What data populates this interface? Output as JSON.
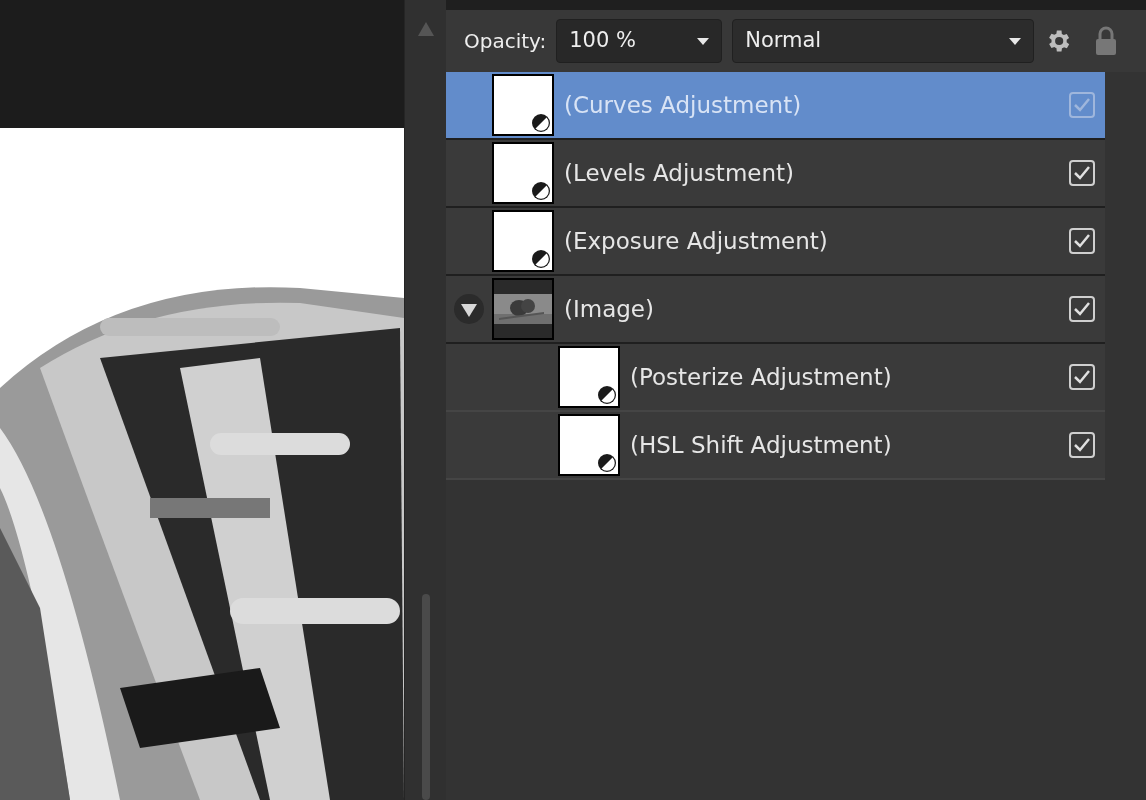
{
  "toolbar": {
    "opacity_label": "Opacity:",
    "opacity_value": "100 %",
    "blend_mode": "Normal"
  },
  "layers": [
    {
      "name": "(Curves Adjustment)",
      "kind": "adjustment",
      "selected": true,
      "visible": true
    },
    {
      "name": "(Levels Adjustment)",
      "kind": "adjustment",
      "selected": false,
      "visible": true
    },
    {
      "name": "(Exposure Adjustment)",
      "kind": "adjustment",
      "selected": false,
      "visible": true
    },
    {
      "name": "(Image)",
      "selected": false,
      "visible": true,
      "expanded": true,
      "children": [
        {
          "name": "(Posterize Adjustment)",
          "kind": "adjustment",
          "selected": false,
          "visible": true
        },
        {
          "name": "(HSL Shift Adjustment)",
          "kind": "adjustment",
          "selected": false,
          "visible": true
        }
      ]
    }
  ]
}
